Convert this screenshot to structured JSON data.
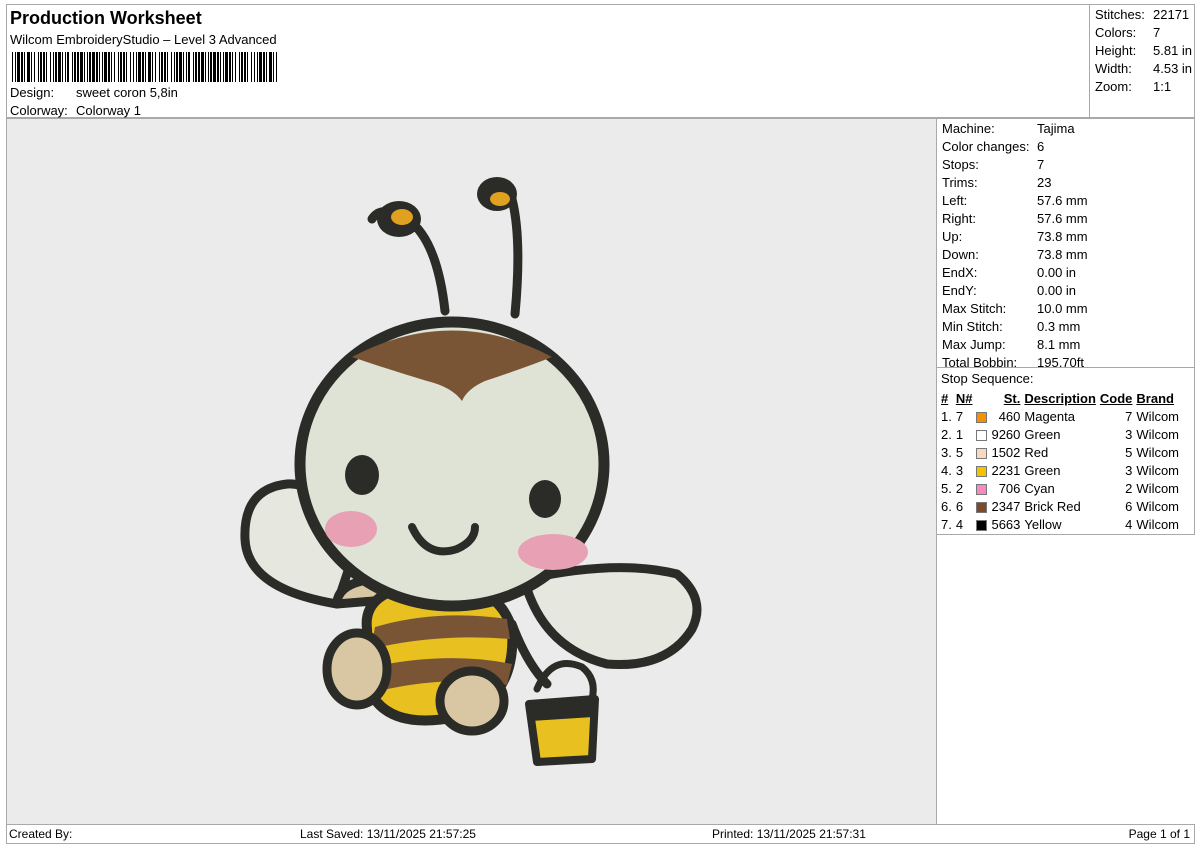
{
  "header": {
    "title": "Production Worksheet",
    "software": "Wilcom EmbroideryStudio – Level 3 Advanced",
    "design_label": "Design:",
    "design_value": "sweet coron 5,8in",
    "colorway_label": "Colorway:",
    "colorway_value": "Colorway 1"
  },
  "stats": [
    {
      "label": "Stitches:",
      "value": "22171"
    },
    {
      "label": "Colors:",
      "value": "7"
    },
    {
      "label": "Height:",
      "value": "5.81 in"
    },
    {
      "label": "Width:",
      "value": "4.53 in"
    },
    {
      "label": "Zoom:",
      "value": "1:1"
    }
  ],
  "info": [
    {
      "label": "Machine:",
      "value": "Tajima"
    },
    {
      "label": "Color changes:",
      "value": "6"
    },
    {
      "label": "Stops:",
      "value": "7"
    },
    {
      "label": "Trims:",
      "value": "23"
    },
    {
      "label": "Left:",
      "value": "57.6 mm"
    },
    {
      "label": "Right:",
      "value": "57.6 mm"
    },
    {
      "label": "Up:",
      "value": "73.8 mm"
    },
    {
      "label": "Down:",
      "value": "73.8 mm"
    },
    {
      "label": "EndX:",
      "value": "0.00 in"
    },
    {
      "label": "EndY:",
      "value": "0.00 in"
    },
    {
      "label": "Max Stitch:",
      "value": "10.0 mm"
    },
    {
      "label": "Min Stitch:",
      "value": "0.3 mm"
    },
    {
      "label": "Max Jump:",
      "value": "8.1 mm"
    },
    {
      "label": "Total Bobbin:",
      "value": "195.70ft"
    }
  ],
  "stop_sequence": {
    "heading": "Stop Sequence:",
    "columns": [
      "#",
      "N#",
      "St.",
      "Description",
      "Code",
      "Brand"
    ],
    "rows": [
      {
        "num": "1.",
        "n": "7",
        "color": "#f39200",
        "st": "460",
        "desc": "Magenta",
        "code": "7",
        "brand": "Wilcom"
      },
      {
        "num": "2.",
        "n": "1",
        "color": "#ffffff",
        "st": "9260",
        "desc": "Green",
        "code": "3",
        "brand": "Wilcom"
      },
      {
        "num": "3.",
        "n": "5",
        "color": "#f7d9c0",
        "st": "1502",
        "desc": "Red",
        "code": "5",
        "brand": "Wilcom"
      },
      {
        "num": "4.",
        "n": "3",
        "color": "#f2c400",
        "st": "2231",
        "desc": "Green",
        "code": "3",
        "brand": "Wilcom"
      },
      {
        "num": "5.",
        "n": "2",
        "color": "#f28cc0",
        "st": "706",
        "desc": "Cyan",
        "code": "2",
        "brand": "Wilcom"
      },
      {
        "num": "6.",
        "n": "6",
        "color": "#7b4a2a",
        "st": "2347",
        "desc": "Brick Red",
        "code": "6",
        "brand": "Wilcom"
      },
      {
        "num": "7.",
        "n": "4",
        "color": "#000000",
        "st": "5663",
        "desc": "Yellow",
        "code": "4",
        "brand": "Wilcom"
      }
    ]
  },
  "footer": {
    "created_by": "Created By:",
    "last_saved": "Last Saved: 13/11/2025 21:57:25",
    "printed": "Printed: 13/11/2025 21:57:31",
    "page": "Page 1 of 1"
  },
  "colors": {
    "canvas_bg": "#ebebeb",
    "outline": "#2b2b27",
    "face": "#dfe3d6",
    "head_brown": "#7a5535",
    "yellow": "#e8c020",
    "stripe_brown": "#7a5535",
    "beige": "#d9c7a3",
    "cheek": "#e8a0b4",
    "antenna_tip": "#e0a020",
    "wing": "#e6e8e0"
  }
}
